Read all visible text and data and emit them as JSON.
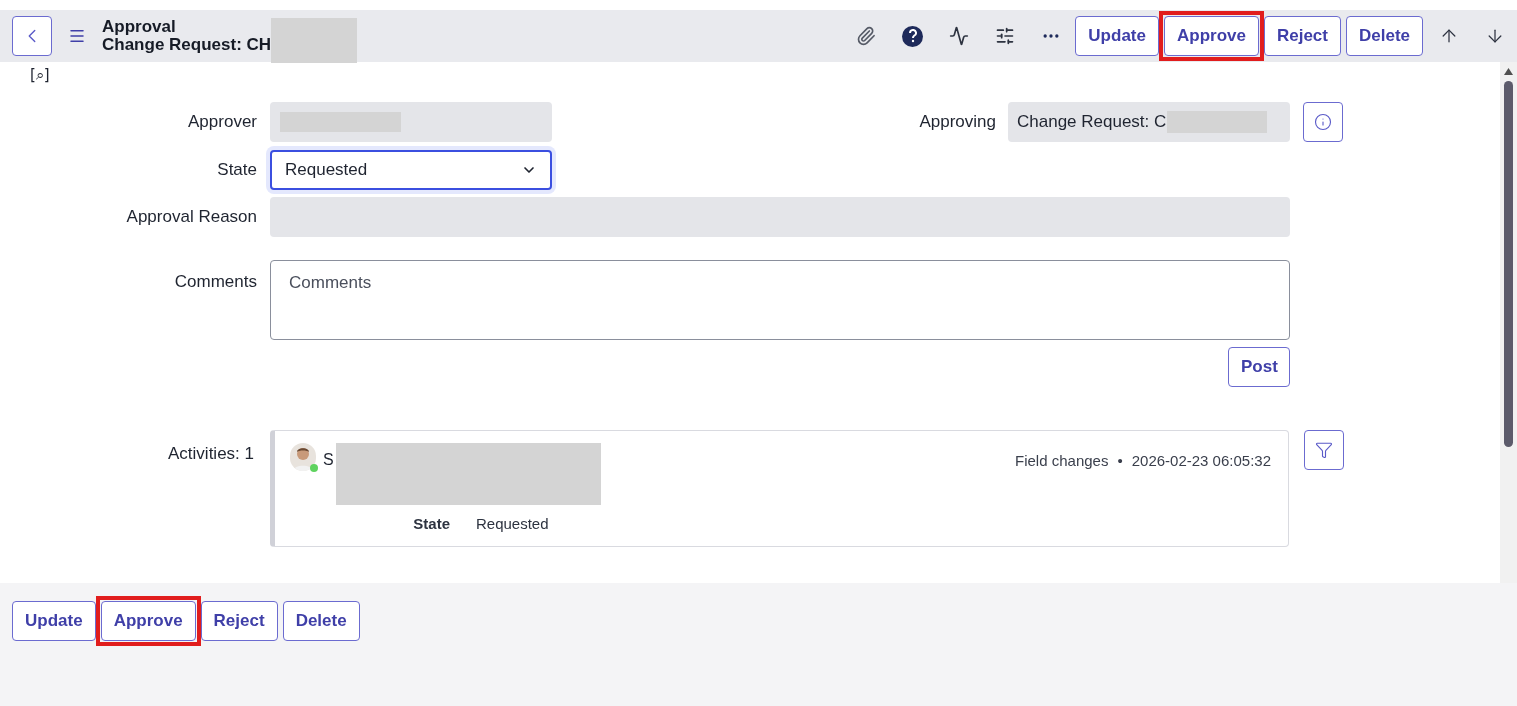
{
  "header": {
    "title": "Approval",
    "subtitle": "Change Request: CH",
    "subtitle_redacted": true
  },
  "toolbar_buttons": [
    {
      "label": "Update",
      "highlighted": false
    },
    {
      "label": "Approve",
      "highlighted": true
    },
    {
      "label": "Reject",
      "highlighted": false
    },
    {
      "label": "Delete",
      "highlighted": false
    }
  ],
  "search_marker": "[⌕]",
  "form": {
    "approver": {
      "label": "Approver",
      "redacted": true
    },
    "approving": {
      "label": "Approving",
      "value": "Change Request: C",
      "redacted": true
    },
    "state": {
      "label": "State",
      "value": "Requested",
      "focused": true
    },
    "approval_reason": {
      "label": "Approval Reason"
    },
    "comments": {
      "label": "Comments",
      "placeholder": "Comments"
    },
    "post_button": "Post"
  },
  "activities": {
    "label": "Activities: 1",
    "entries": [
      {
        "author": "S",
        "redacted": true,
        "online": true,
        "type": "Field changes",
        "separator": "•",
        "time": "2026-02-23 06:05:32",
        "changes": [
          {
            "field": "State",
            "value": "Requested"
          }
        ]
      }
    ]
  },
  "footer_buttons": [
    {
      "label": "Update",
      "highlighted": false
    },
    {
      "label": "Approve",
      "highlighted": true
    },
    {
      "label": "Reject",
      "highlighted": false
    },
    {
      "label": "Delete",
      "highlighted": false
    }
  ]
}
